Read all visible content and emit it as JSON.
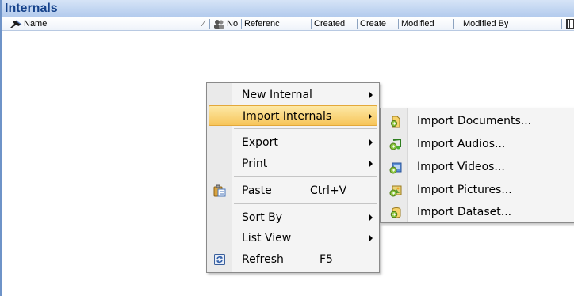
{
  "window": {
    "title": "Internals"
  },
  "columns": [
    {
      "label": "Name"
    },
    {
      "label": "No"
    },
    {
      "label": "Referenc"
    },
    {
      "label": "Created"
    },
    {
      "label": "Create"
    },
    {
      "label": "Modified"
    },
    {
      "label": "Modified By"
    }
  ],
  "context_menu": {
    "items": [
      {
        "label": "New Internal",
        "has_submenu": true
      },
      {
        "label": "Import Internals",
        "has_submenu": true,
        "highlighted": true
      },
      {
        "label": "Export",
        "has_submenu": true
      },
      {
        "label": "Print",
        "has_submenu": true
      },
      {
        "label": "Paste",
        "shortcut": "Ctrl+V",
        "icon": "paste-icon"
      },
      {
        "label": "Sort By",
        "has_submenu": true
      },
      {
        "label": "List View",
        "has_submenu": true
      },
      {
        "label": "Refresh",
        "shortcut": "F5",
        "icon": "refresh-icon"
      }
    ]
  },
  "submenu": {
    "items": [
      {
        "label": "Import Documents...",
        "icon": "document-import-icon"
      },
      {
        "label": "Import Audios...",
        "icon": "audio-import-icon"
      },
      {
        "label": "Import Videos...",
        "icon": "video-import-icon"
      },
      {
        "label": "Import Pictures...",
        "icon": "picture-import-icon"
      },
      {
        "label": "Import Dataset...",
        "icon": "dataset-import-icon"
      }
    ]
  },
  "colors": {
    "title_text": "#15428b",
    "highlight_top": "#fde9a6",
    "highlight_bottom": "#f7c55a"
  }
}
